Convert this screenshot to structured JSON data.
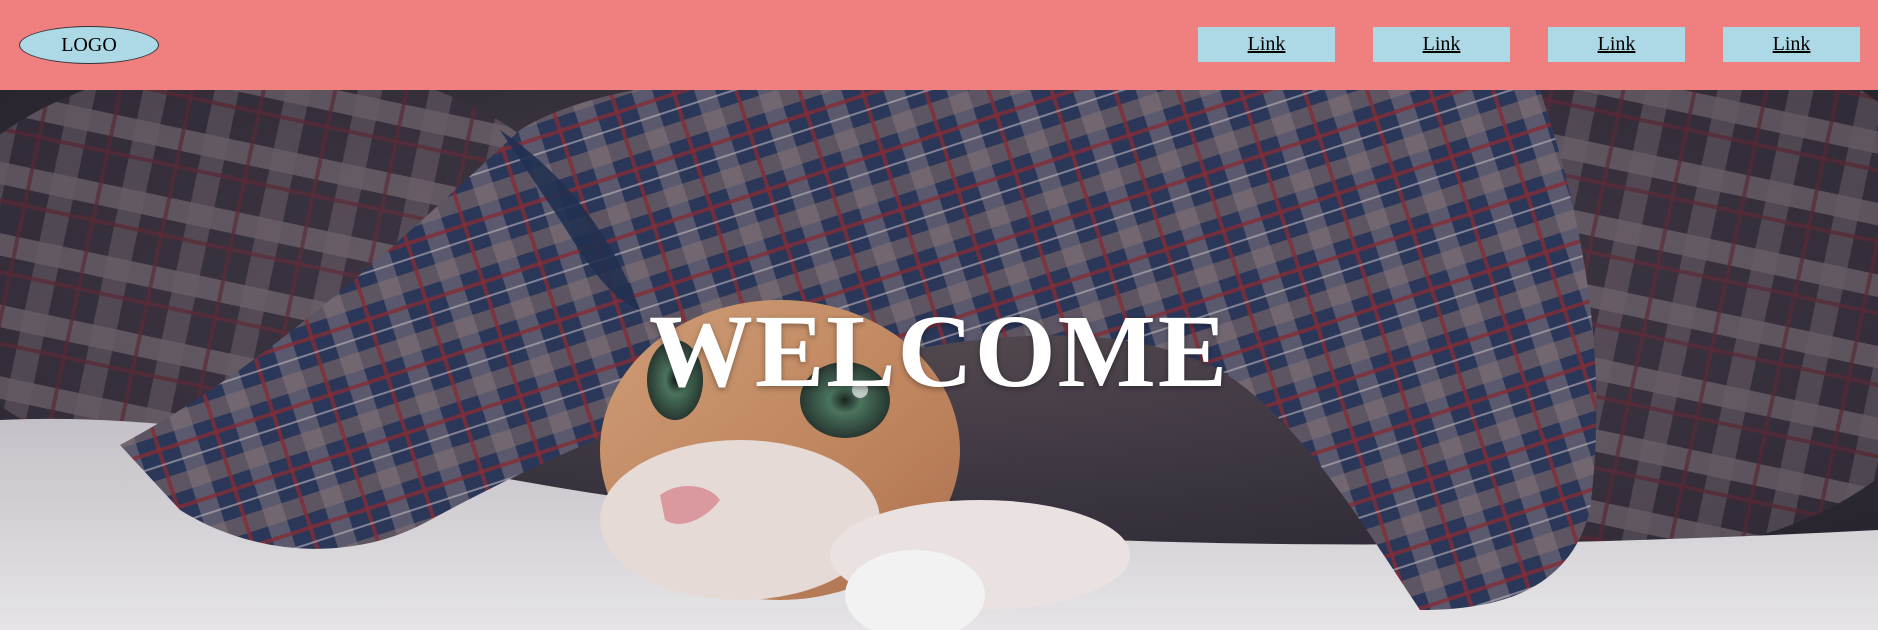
{
  "header": {
    "logo_label": "LOGO",
    "background_color": "#f08080",
    "element_color": "#add8e6",
    "nav_links": [
      {
        "label": "Link"
      },
      {
        "label": "Link"
      },
      {
        "label": "Link"
      },
      {
        "label": "Link"
      }
    ]
  },
  "hero": {
    "headline": "WELCOME",
    "image_subject": "kitten peeking out from under a plaid blanket"
  }
}
